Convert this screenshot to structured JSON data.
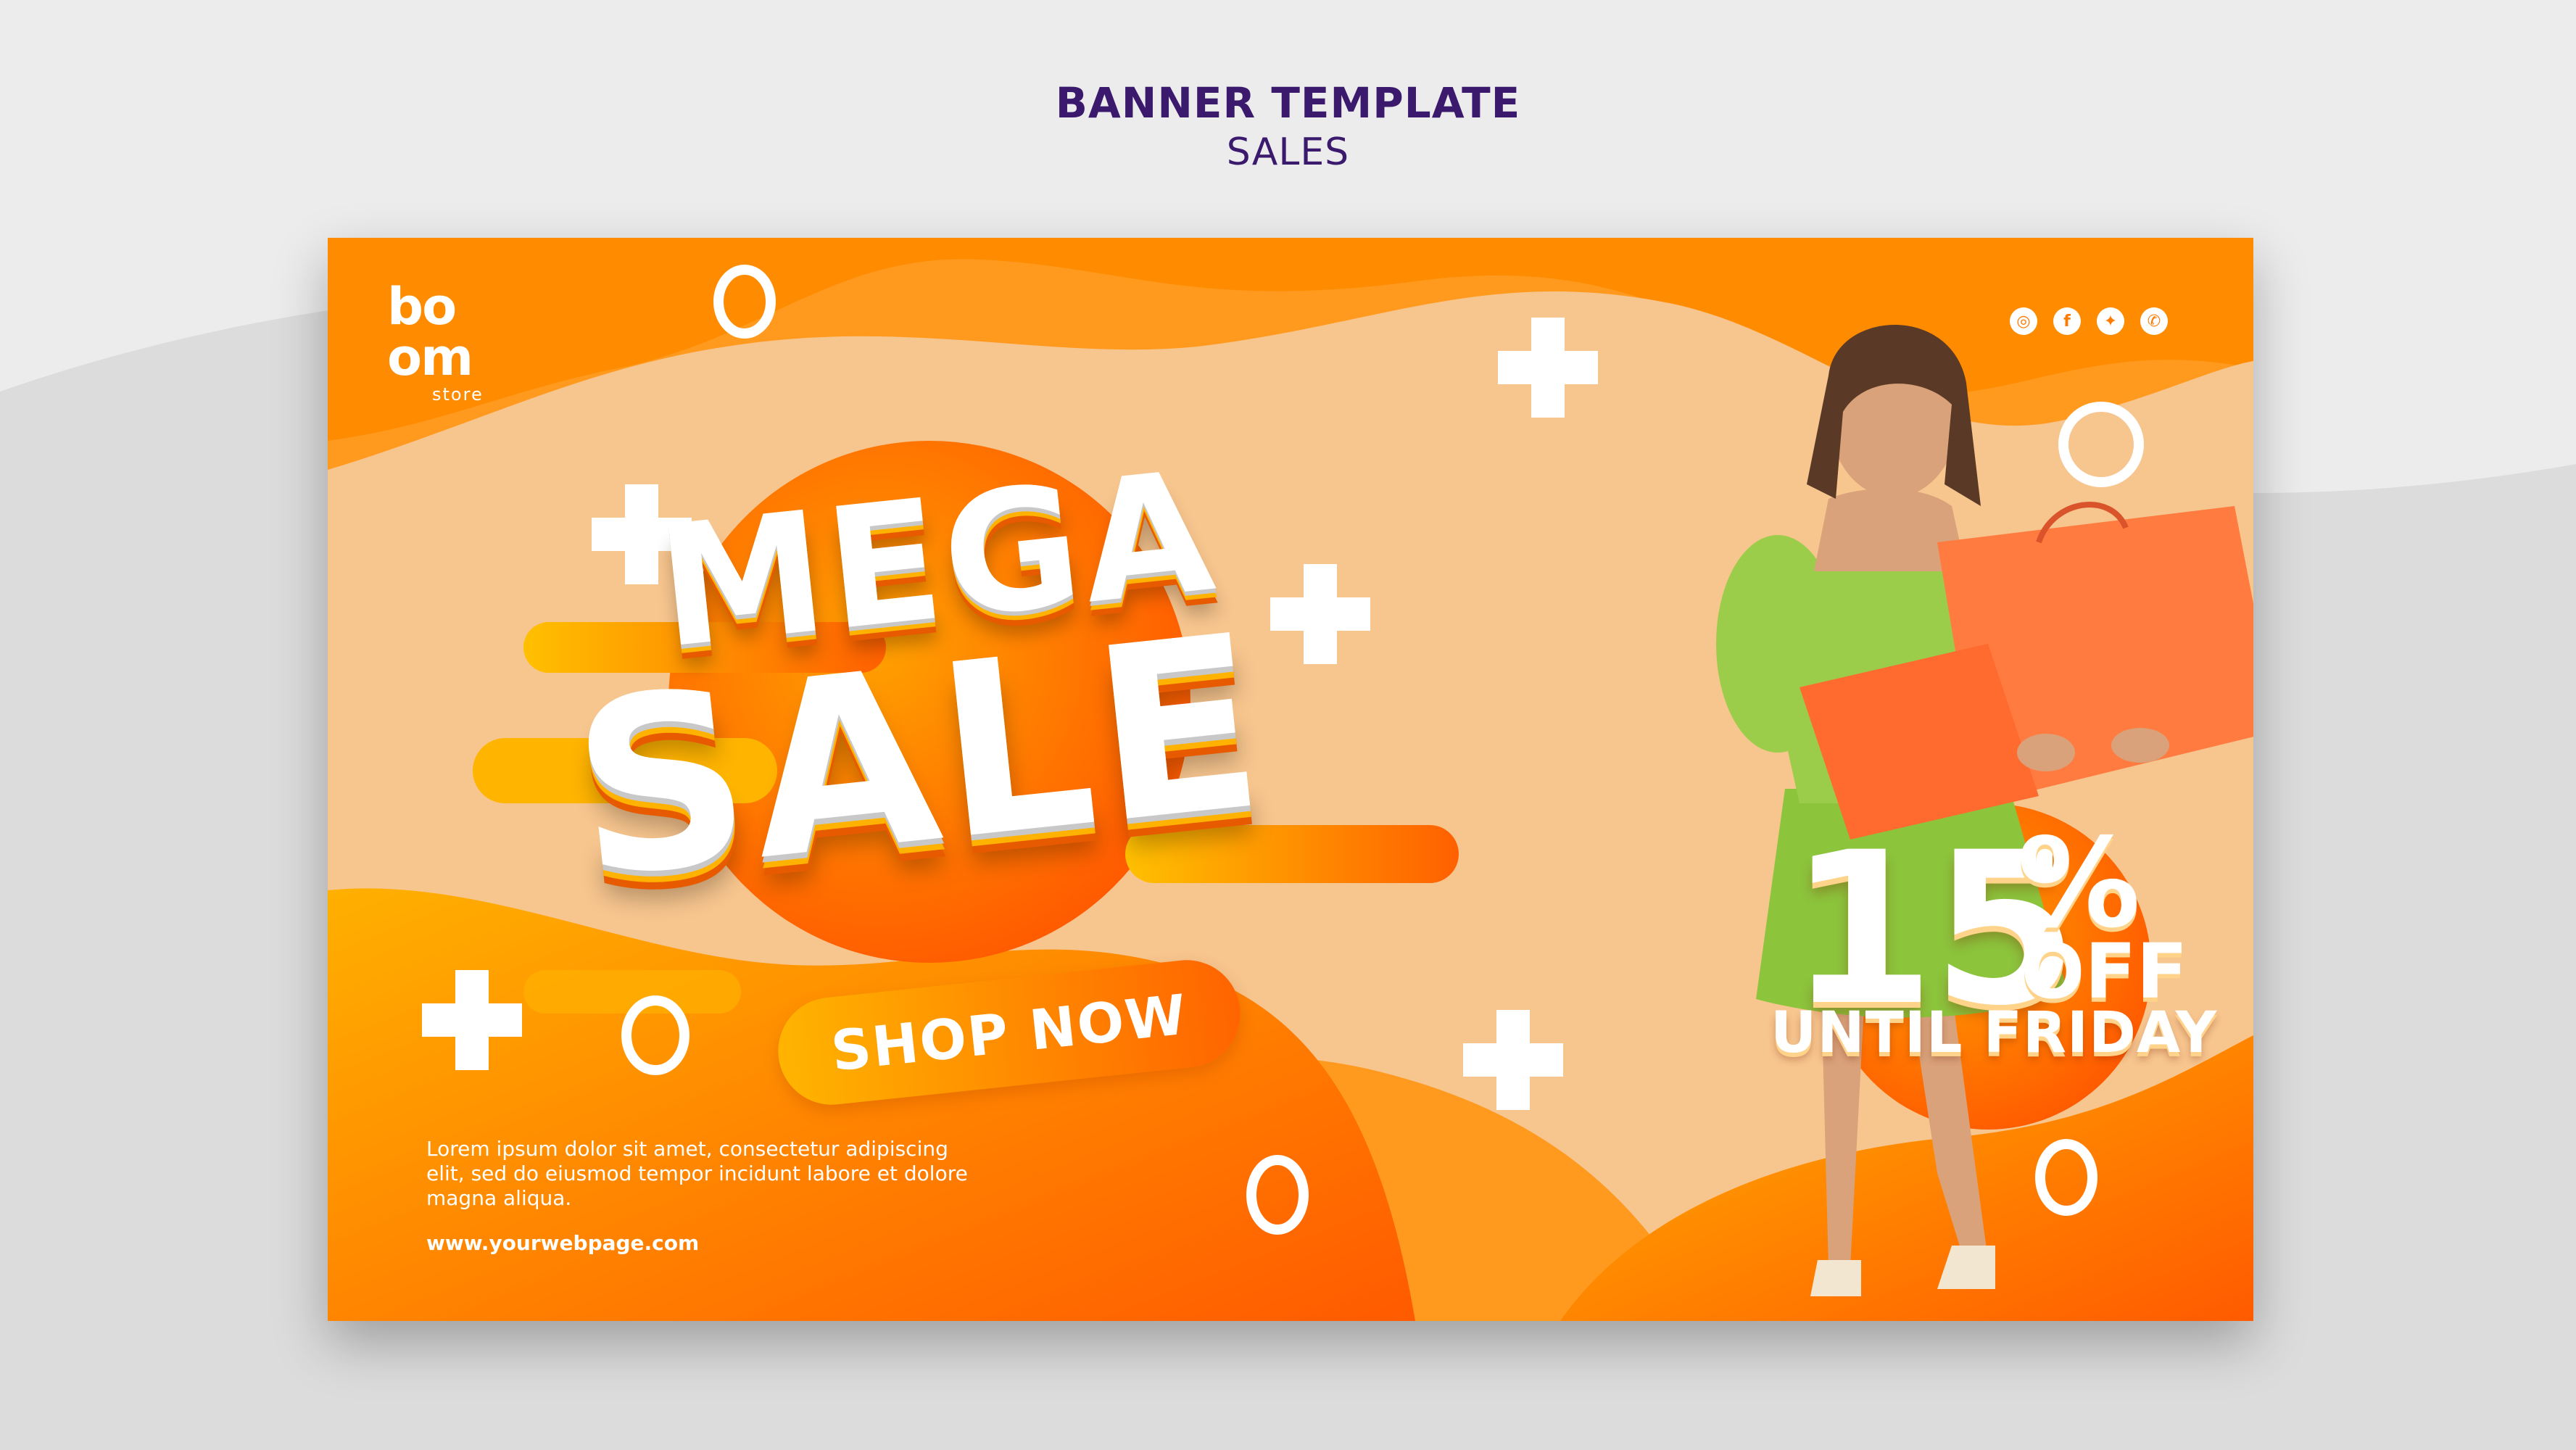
{
  "page": {
    "title": "BANNER TEMPLATE",
    "subtitle": "SALES"
  },
  "brand": {
    "logo_line1": "bo",
    "logo_line2": "om",
    "logo_line3": "store"
  },
  "social_icons": [
    "instagram-icon",
    "facebook-icon",
    "twitter-icon",
    "whatsapp-icon"
  ],
  "headline": {
    "line1": "MEGA",
    "line2": "SALE"
  },
  "cta": {
    "label": "SHOP NOW"
  },
  "description": "Lorem ipsum dolor sit amet, consectetur adipiscing elit, sed do eiusmod tempor incidunt labore et dolore magna aliqua.",
  "website": "www.yourwebpage.com",
  "discount": {
    "amount": "15",
    "percent_sign": "%",
    "off_label": "OFF",
    "until_label": "UNTIL FRIDAY"
  },
  "colors": {
    "page_background": "#e9e9e9",
    "heading": "#3b1a6e",
    "orange": "#ff8f1a",
    "deep_orange": "#ff5f00",
    "peach": "#f5c48a",
    "white": "#ffffff",
    "dress_green": "#8cc43c"
  }
}
